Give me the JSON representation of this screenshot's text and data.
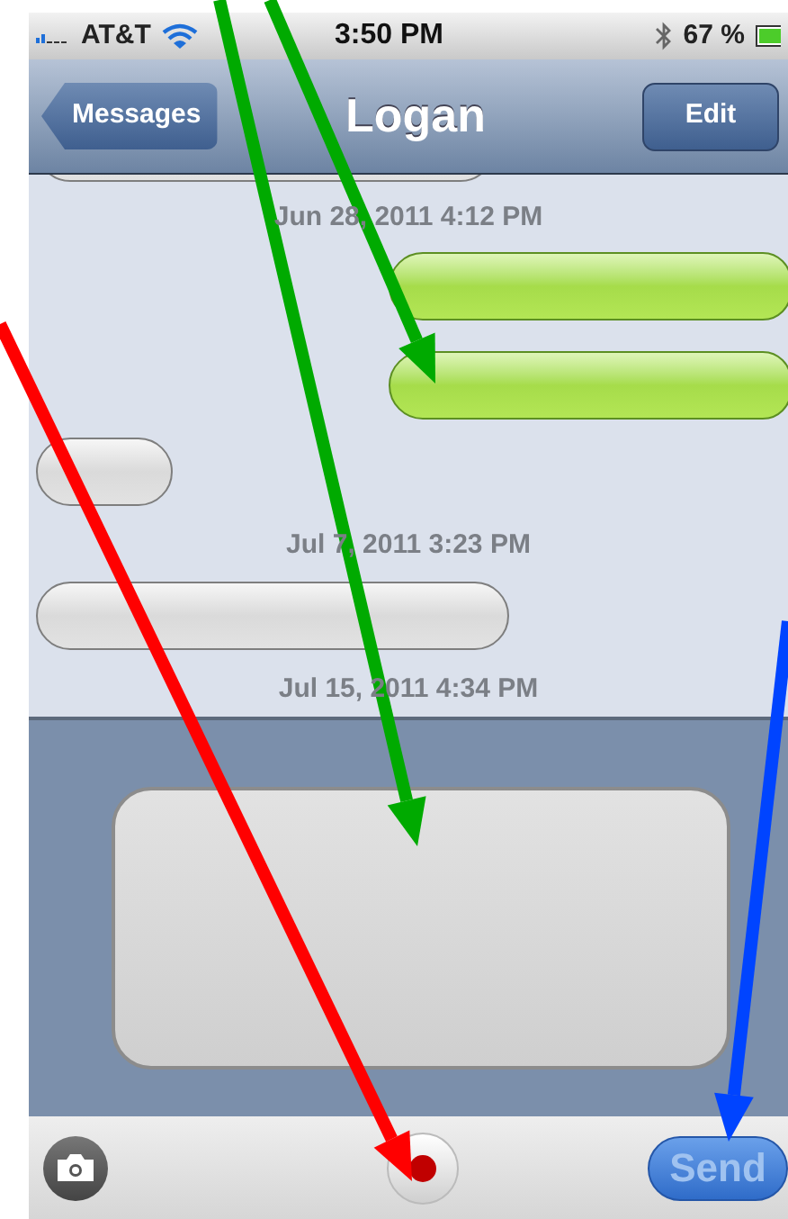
{
  "status_bar": {
    "carrier": "AT&T",
    "time": "3:50 PM",
    "battery_text": "67 %"
  },
  "nav_bar": {
    "back_label": "Messages",
    "title": "Logan",
    "edit_label": "Edit"
  },
  "messages": [
    {
      "kind": "received"
    },
    {
      "kind": "timestamp",
      "text": "Jun 28, 2011 4:12 PM"
    },
    {
      "kind": "sent"
    },
    {
      "kind": "sent"
    },
    {
      "kind": "received"
    },
    {
      "kind": "timestamp",
      "text": "Jul 7, 2011 3:23 PM"
    },
    {
      "kind": "received"
    },
    {
      "kind": "timestamp",
      "text": "Jul 15, 2011 4:34 PM"
    }
  ],
  "toolbar": {
    "send_label": "Send",
    "send_disabled": true
  },
  "annotations": [
    {
      "color": "#00aa00"
    },
    {
      "color": "#00aa00"
    },
    {
      "color": "#ff0000"
    },
    {
      "color": "#0044ff"
    }
  ]
}
